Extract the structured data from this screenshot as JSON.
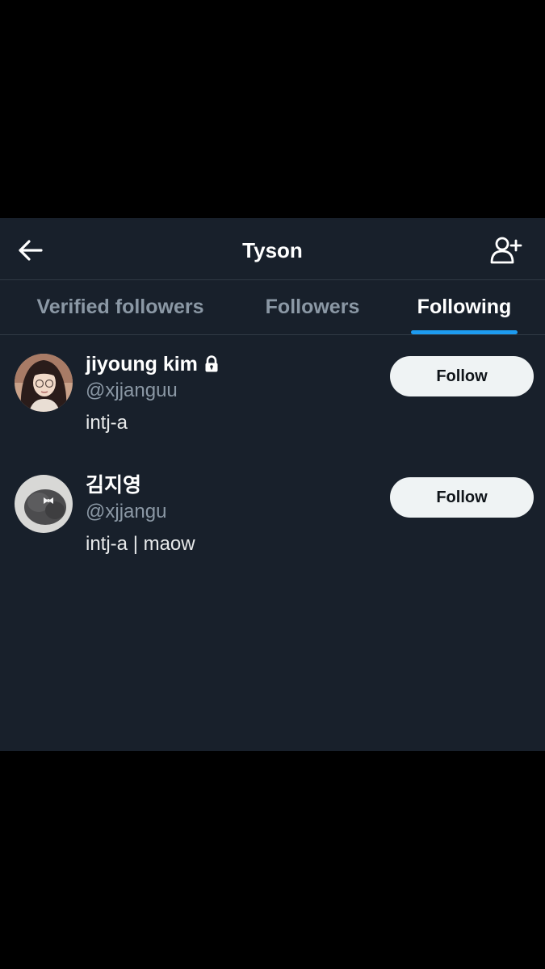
{
  "header": {
    "title": "Tyson",
    "back_icon": "arrow-left-icon",
    "add_user_icon": "person-plus-icon"
  },
  "tabs": [
    {
      "label": "Verified followers",
      "active": false
    },
    {
      "label": "Followers",
      "active": false
    },
    {
      "label": "Following",
      "active": true
    }
  ],
  "users": [
    {
      "name": "jiyoung kim",
      "handle": "@xjjanguu",
      "bio": "intj-a",
      "protected": true,
      "follow_label": "Follow",
      "avatar": "illustrated-girl-avatar"
    },
    {
      "name": "김지영",
      "handle": "@xjjangu",
      "bio": "intj-a | maow",
      "protected": false,
      "follow_label": "Follow",
      "avatar": "dark-hair-bun-avatar"
    }
  ],
  "colors": {
    "background": "#18202b",
    "outer": "#000000",
    "accent": "#1d9bf0",
    "text_primary": "#ffffff",
    "text_secondary": "#8b98a5",
    "divider": "#303a45",
    "button_bg": "#eff3f4"
  }
}
